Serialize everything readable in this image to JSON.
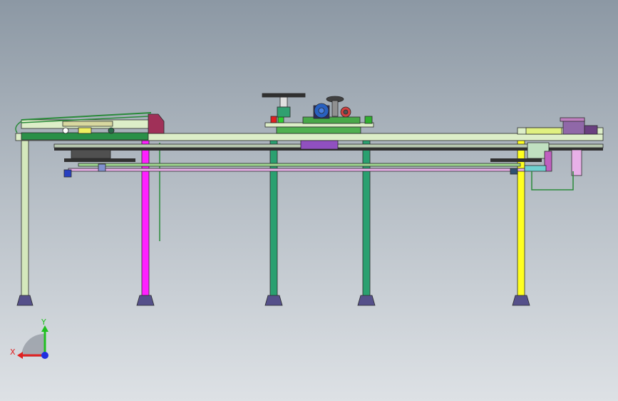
{
  "viewport": {
    "background_top": "#8c98a4",
    "background_bottom": "#dde1e5"
  },
  "triad": {
    "x_label": "X",
    "y_label": "Y",
    "x_color": "#e02020",
    "y_color": "#20c020",
    "z_color": "#2030e0"
  },
  "colors": {
    "beam": "#ddeec8",
    "leg_light": "#d4e8bc",
    "leg_magenta": "#ff20ff",
    "leg_teal": "#2aa070",
    "leg_yellow": "#ffff20",
    "rail_pink": "#e8b0e8",
    "feet": "#55508a",
    "motor_blue": "#2860c0",
    "purple_block": "#9050c0",
    "maroon_plate": "#a03058",
    "green_carriage": "#50b050"
  },
  "model_parts": [
    "main-beam",
    "left-frame",
    "center-carriage",
    "motor",
    "handwheel",
    "right-end-assembly",
    "rack-rail",
    "guide-rail",
    "support-legs"
  ]
}
